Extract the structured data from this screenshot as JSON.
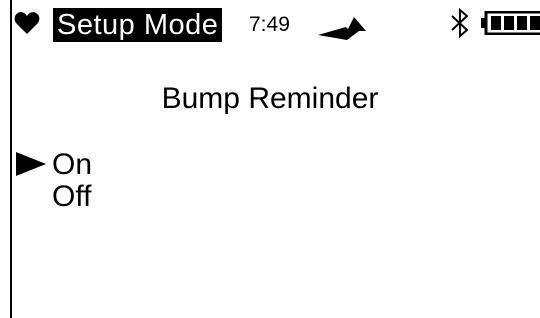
{
  "status": {
    "mode_label": "Setup Mode",
    "time": "7:49",
    "icons": [
      "heart-icon",
      "signal-icon",
      "bluetooth-icon",
      "battery-icon"
    ]
  },
  "screen": {
    "title": "Bump Reminder"
  },
  "menu": {
    "items": [
      {
        "label": "On",
        "selected": true
      },
      {
        "label": "Off",
        "selected": false
      }
    ],
    "pointer_icon": "right-triangle-pointer"
  }
}
